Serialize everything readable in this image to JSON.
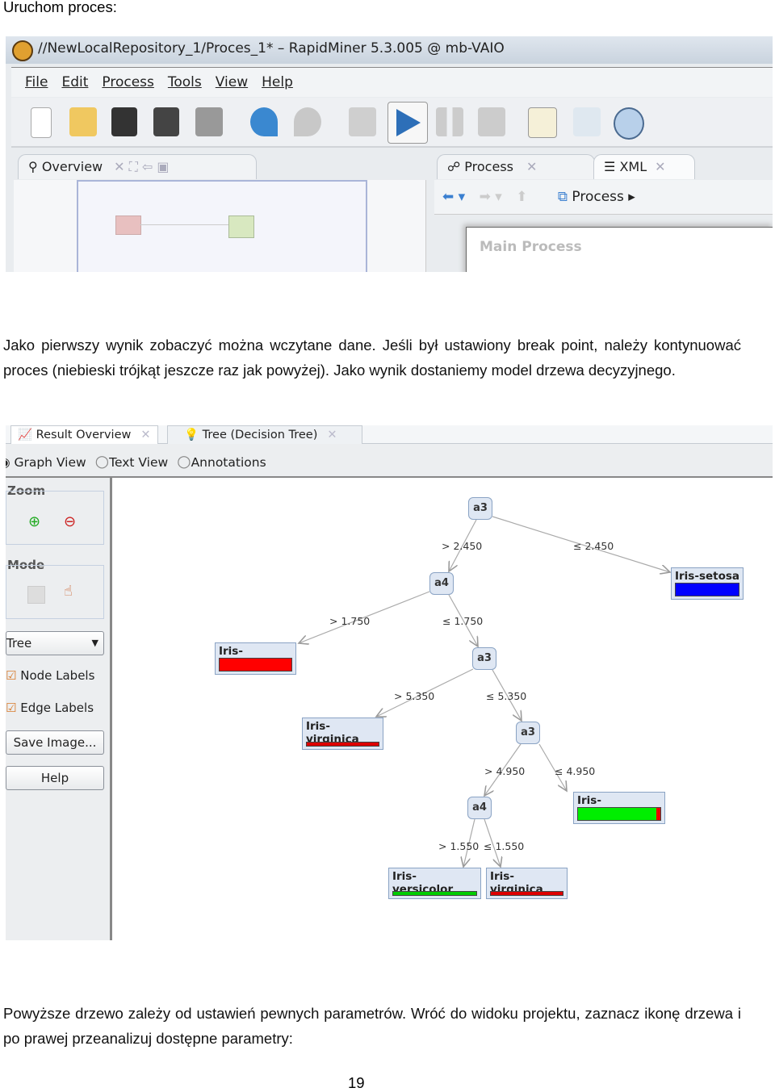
{
  "heading": "Uruchom proces:",
  "screenshot1": {
    "title": "//NewLocalRepository_1/Proces_1* – RapidMiner 5.3.005 @ mb-VAIO",
    "menu": [
      "File",
      "Edit",
      "Process",
      "Tools",
      "View",
      "Help"
    ],
    "toolbar_icons": [
      "new-icon",
      "open-folder-icon",
      "save-icon",
      "save-as-icon",
      "print-icon",
      "undo-icon",
      "redo-icon",
      "validate-icon",
      "run-icon",
      "pause-icon",
      "stop-icon",
      "notes-icon",
      "results-icon",
      "info-icon"
    ],
    "left_tab": "Overview",
    "right_tabs": [
      "Process",
      "XML"
    ],
    "breadcrumb": "Process",
    "canvas_label": "Main Process"
  },
  "paragraph1": "Jako pierwszy wynik zobaczyć można wczytane dane. Jeśli był ustawiony break point, należy kontynuować proces (niebieski trójkąt jeszcze raz jak powyżej). Jako wynik dostaniemy model drzewa decyzyjnego.",
  "screenshot2": {
    "tabs": [
      "Result Overview",
      "Tree (Decision Tree)"
    ],
    "views": [
      "Graph View",
      "Text View",
      "Annotations"
    ],
    "selected_view": "Graph View",
    "zoom_label": "Zoom",
    "mode_label": "Mode",
    "layout_select": "Tree",
    "node_labels": {
      "label": "Node Labels",
      "checked": true
    },
    "edge_labels": {
      "label": "Edge Labels",
      "checked": true
    },
    "save_image": "Save Image...",
    "help": "Help",
    "colors": {
      "Iris-setosa": "#0000ff",
      "Iris-virginica": "#ff0000",
      "Iris-versicolor": "#00ee00"
    },
    "tree": {
      "nodes": [
        "a3",
        "a4",
        "a3",
        "a3",
        "a4"
      ],
      "leaves": [
        "Iris-setosa",
        "Iris-virginica",
        "Iris-virginica",
        "Iris-versicolor",
        "Iris-versicolor",
        "Iris-virginica"
      ],
      "edges": [
        "> 2.450",
        "≤ 2.450",
        "> 1.750",
        "≤ 1.750",
        "> 5.350",
        "≤ 5.350",
        "> 4.950",
        "≤ 4.950",
        "> 1.550",
        "≤ 1.550"
      ]
    }
  },
  "paragraph2": "Powyższe drzewo zależy od ustawień pewnych parametrów. Wróć do widoku projektu, zaznacz ikonę drzewa i po prawej przeanalizuj dostępne parametry:",
  "page_number": "19"
}
